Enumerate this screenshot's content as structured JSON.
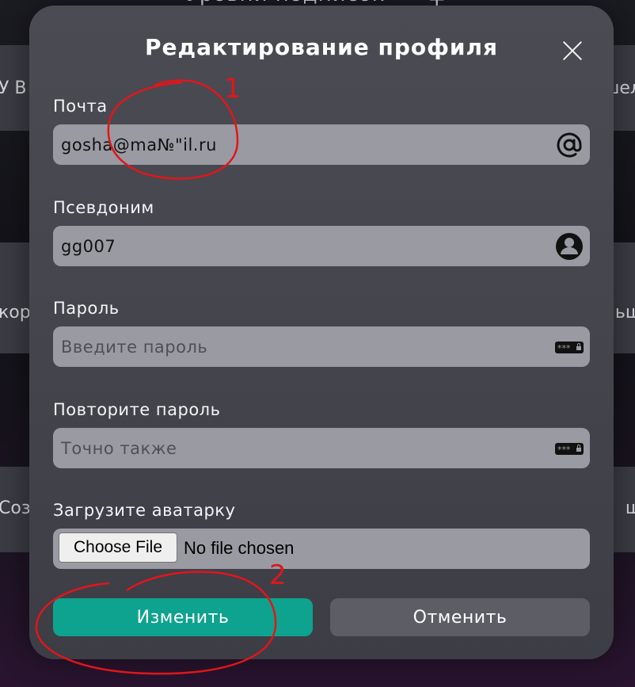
{
  "background": {
    "title": "Уровни подписок",
    "rows": [
      {
        "left": "У В",
        "right": "шел"
      },
      {
        "left": "кор",
        "right": "ьш"
      },
      {
        "left": "Созд",
        "right": "ш"
      }
    ]
  },
  "modal": {
    "title": "Редактирование профиля",
    "fields": [
      {
        "label": "Почта",
        "value": "gosha@ma№\"il.ru",
        "placeholder": "",
        "icon": "at-icon"
      },
      {
        "label": "Псевдоним",
        "value": "gg007",
        "placeholder": "",
        "icon": "user-icon"
      },
      {
        "label": "Пароль",
        "value": "",
        "placeholder": "Введите пароль",
        "icon": "password-icon"
      },
      {
        "label": "Повторите пароль",
        "value": "",
        "placeholder": "Точно также",
        "icon": "password-icon"
      }
    ],
    "avatar": {
      "label": "Загрузите аватарку",
      "choose_label": "Choose File",
      "status": "No file chosen"
    },
    "submit_label": "Изменить",
    "cancel_label": "Отменить"
  },
  "annotations": {
    "mark_1": "1",
    "mark_2": "2",
    "color": "#e0161b"
  },
  "colors": {
    "accent": "#0ea38e",
    "input_bg": "#9a9aa2",
    "modal_bg": "#47474f"
  }
}
